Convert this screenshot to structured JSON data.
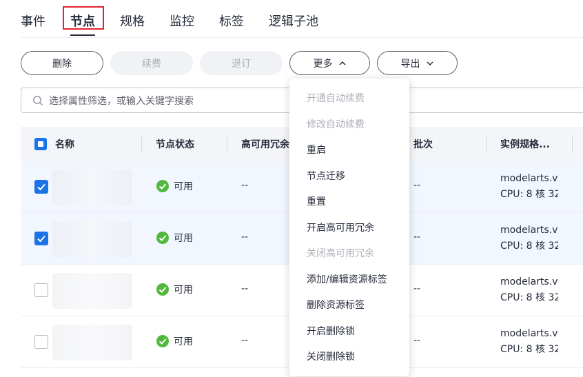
{
  "tabs": [
    "事件",
    "节点",
    "规格",
    "监控",
    "标签",
    "逻辑子池"
  ],
  "active_tab": "节点",
  "toolbar": {
    "delete": "删除",
    "renew": "续费",
    "unsubscribe": "退订",
    "more": "更多",
    "export": "导出"
  },
  "search": {
    "placeholder": "选择属性筛选，或输入关键字搜索"
  },
  "table": {
    "columns": [
      "名称",
      "节点状态",
      "高可用冗余",
      "批次",
      "实例规格..."
    ],
    "rows": [
      {
        "selected": true,
        "status": "可用",
        "ha": "--",
        "batch": "--",
        "spec1": "modelarts.vm",
        "spec2": "CPU: 8 核 32"
      },
      {
        "selected": true,
        "status": "可用",
        "ha": "--",
        "batch": "--",
        "spec1": "modelarts.vm",
        "spec2": "CPU: 8 核 32"
      },
      {
        "selected": false,
        "status": "可用",
        "ha": "--",
        "batch": "--",
        "spec1": "modelarts.vm",
        "spec2": "CPU: 8 核 32"
      },
      {
        "selected": false,
        "status": "可用",
        "ha": "--",
        "batch": "--",
        "spec1": "modelarts.vm",
        "spec2": "CPU: 8 核 32"
      }
    ]
  },
  "more_menu": [
    {
      "label": "开通自动续费",
      "disabled": true
    },
    {
      "label": "修改自动续费",
      "disabled": true
    },
    {
      "label": "重启",
      "disabled": false
    },
    {
      "label": "节点迁移",
      "disabled": false
    },
    {
      "label": "重置",
      "disabled": false
    },
    {
      "label": "开启高可用冗余",
      "disabled": false
    },
    {
      "label": "关闭高可用冗余",
      "disabled": true
    },
    {
      "label": "添加/编辑资源标签",
      "disabled": false
    },
    {
      "label": "删除资源标签",
      "disabled": false
    },
    {
      "label": "开启删除锁",
      "disabled": false
    },
    {
      "label": "关闭删除锁",
      "disabled": false
    }
  ],
  "colors": {
    "accent": "#1a73e8",
    "success": "#50b83c",
    "highlight": "#e3222b"
  }
}
